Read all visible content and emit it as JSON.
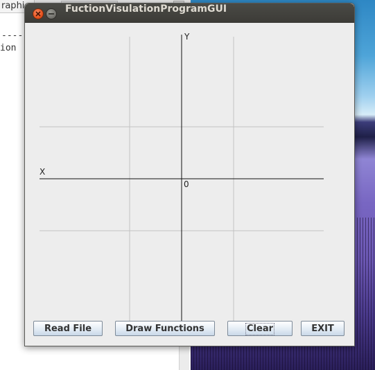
{
  "background": {
    "editor_tab_label": "raphic",
    "code_line_1": "----",
    "code_line_2": "ion"
  },
  "window": {
    "title": "FuctionVisulationProgramGUI"
  },
  "plot": {
    "x_axis_label": "X",
    "y_axis_label": "Y",
    "origin_label": "0"
  },
  "buttons": {
    "read_file": "Read File",
    "draw_functions": "Draw Functions",
    "clear": "Clear",
    "exit": "EXIT"
  },
  "colors": {
    "titlebar": "#3c3b37",
    "window_bg": "#ededed",
    "close_button": "#e8531f",
    "axis": "#000000",
    "grid": "#c0c0c0"
  }
}
